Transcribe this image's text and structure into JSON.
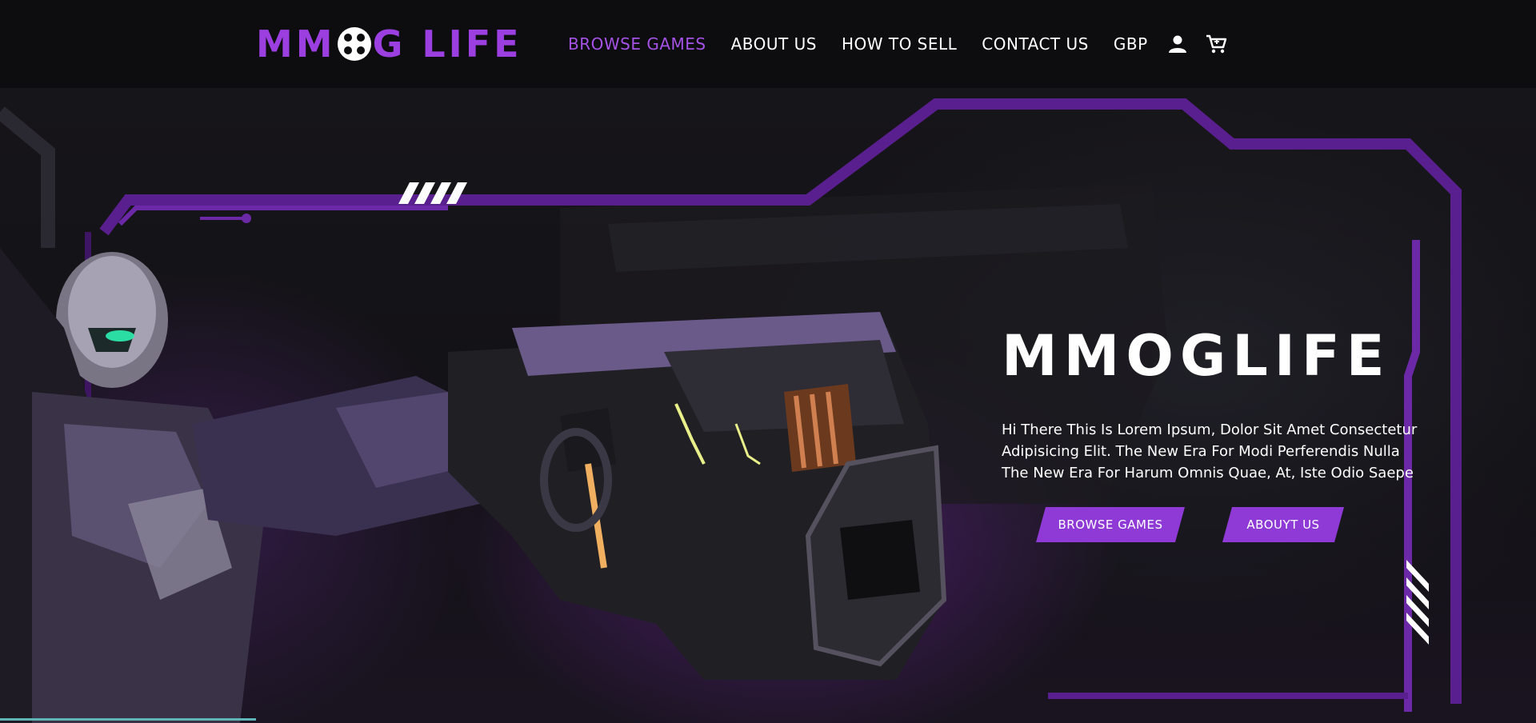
{
  "header": {
    "logo_text_left": "MM",
    "logo_text_right": "G LIFE",
    "nav": [
      {
        "label": "BROWSE GAMES",
        "active": true
      },
      {
        "label": "ABOUT US",
        "active": false
      },
      {
        "label": "HOW TO SELL",
        "active": false
      },
      {
        "label": "CONTACT US",
        "active": false
      },
      {
        "label": "GBP",
        "active": false
      }
    ],
    "icons": [
      "user-icon",
      "cart-icon"
    ]
  },
  "hero": {
    "title": "MMOGLIFE",
    "description": "Hi There This Is Lorem Ipsum, Dolor Sit Amet Consectetur Adipisicing Elit. The New Era For Modi Perferendis Nulla The New Era For Harum Omnis Quae, At, Iste Odio Saepe",
    "primary_button": "BROWSE GAMES",
    "secondary_button": "ABOUYT US"
  },
  "colors": {
    "accent": "#9b3fe0",
    "nav_active": "#a552e6",
    "button": "#8f3ad6",
    "frame": "#5a1f8f",
    "background": "#0d0d0f"
  }
}
